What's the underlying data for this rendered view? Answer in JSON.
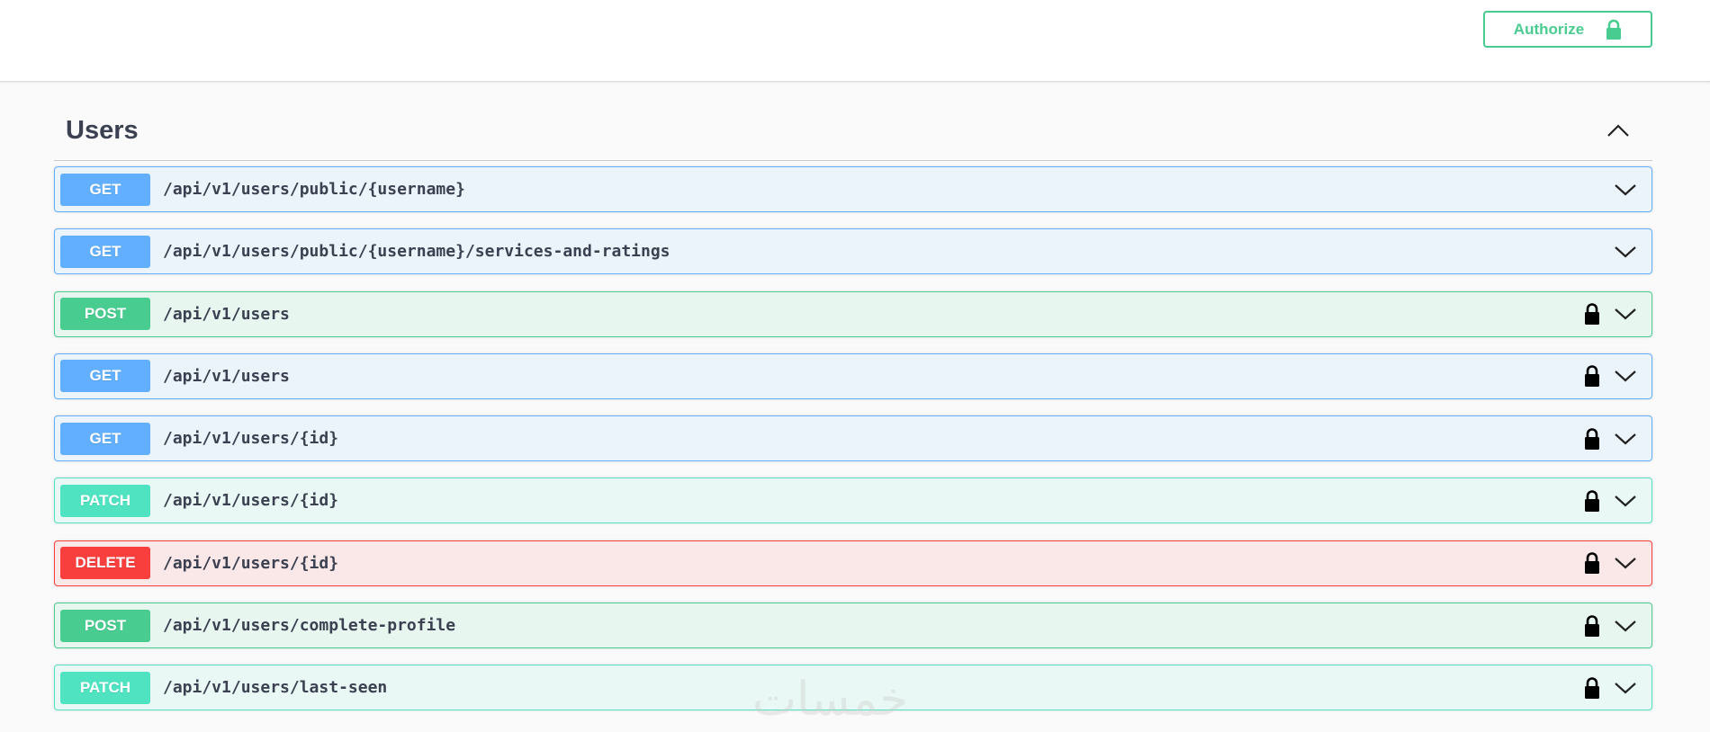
{
  "header": {
    "authorize_label": "Authorize",
    "lock_icon": "lock-icon"
  },
  "section": {
    "title": "Users",
    "collapse_icon": "chevron-up-icon"
  },
  "operations": [
    {
      "method": "GET",
      "path": "/api/v1/users/public/{username}",
      "locked": false
    },
    {
      "method": "GET",
      "path": "/api/v1/users/public/{username}/services-and-ratings",
      "locked": false
    },
    {
      "method": "POST",
      "path": "/api/v1/users",
      "locked": true
    },
    {
      "method": "GET",
      "path": "/api/v1/users",
      "locked": true
    },
    {
      "method": "GET",
      "path": "/api/v1/users/{id}",
      "locked": true
    },
    {
      "method": "PATCH",
      "path": "/api/v1/users/{id}",
      "locked": true
    },
    {
      "method": "DELETE",
      "path": "/api/v1/users/{id}",
      "locked": true
    },
    {
      "method": "POST",
      "path": "/api/v1/users/complete-profile",
      "locked": true
    },
    {
      "method": "PATCH",
      "path": "/api/v1/users/last-seen",
      "locked": true
    }
  ],
  "colors": {
    "get": "#61affe",
    "post": "#49cc90",
    "patch": "#50e3c2",
    "delete": "#f93e3e",
    "text": "#3b4151"
  },
  "watermark": "خمسات"
}
